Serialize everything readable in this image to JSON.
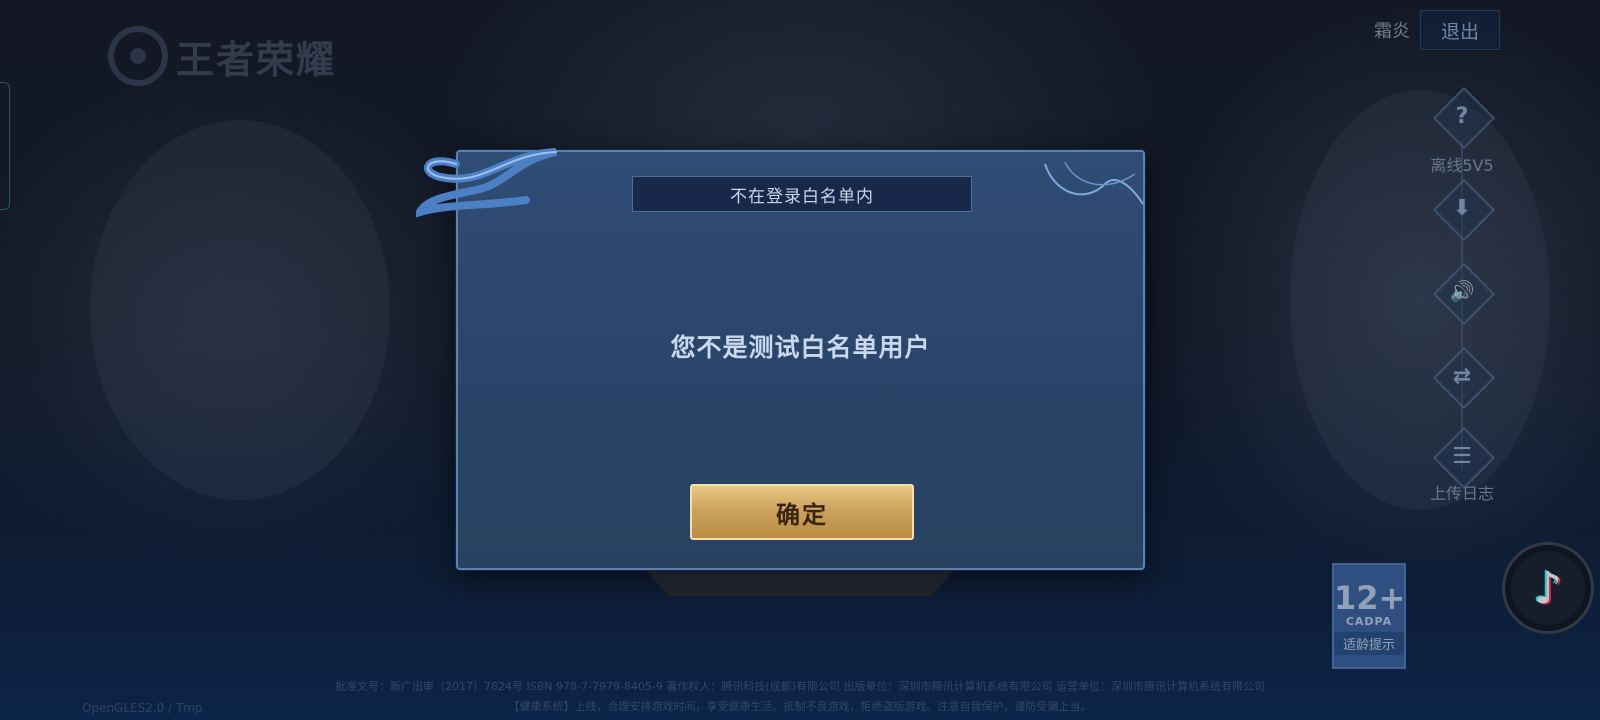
{
  "logo": {
    "text": "王者荣耀"
  },
  "header": {
    "user_name": "霜炎",
    "logout_label": "退出"
  },
  "side_menu": {
    "items": [
      {
        "label": "离线5V5",
        "icon": "question-icon",
        "glyph": "?"
      },
      {
        "label": "",
        "icon": "download-icon",
        "glyph": "⬇"
      },
      {
        "label": "",
        "icon": "speaker-icon",
        "glyph": "🔊"
      },
      {
        "label": "",
        "icon": "switch-account-icon",
        "glyph": "⇄"
      },
      {
        "label": "上传日志",
        "icon": "clipboard-icon",
        "glyph": "☰"
      }
    ]
  },
  "age_rating": {
    "age": "12+",
    "org": "CADPA",
    "tip": "适龄提示"
  },
  "tiktok": {
    "icon": "tiktok-icon",
    "glyph": "♪"
  },
  "dialog": {
    "title": "不在登录白名单内",
    "message": "您不是测试白名单用户",
    "confirm_label": "确定"
  },
  "footer": {
    "line1": "批准文号：新广出审〔2017〕7824号 ISBN 978-7-7979-8405-9 著作权人：腾讯科技(成都)有限公司 出版单位：深圳市腾讯计算机系统有限公司 运营单位：深圳市腾讯计算机系统有限公司",
    "line2": "【健康系统】上线，合理安排游戏时间，享受健康生活。抵制不良游戏，拒绝盗版游戏。注意自我保护，谨防受骗上当。",
    "build": "OpenGLES2.0 / Tmp"
  },
  "colors": {
    "accent_gold": "#cda35c",
    "dialog_border": "#5c82b4",
    "dialog_bg": "#2a4468"
  }
}
